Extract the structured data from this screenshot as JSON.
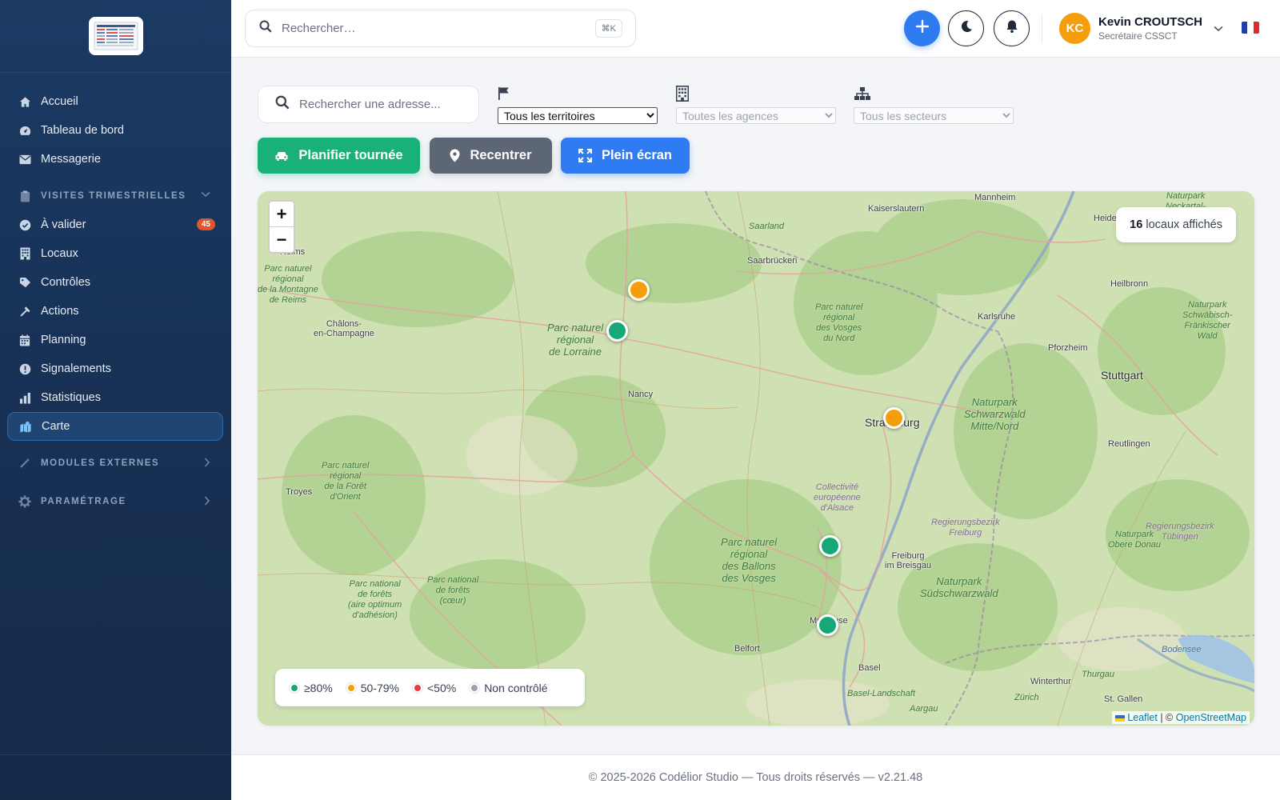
{
  "sidebar": {
    "nav_top": [
      {
        "label": "Accueil",
        "icon": "home-icon"
      },
      {
        "label": "Tableau de bord",
        "icon": "dashboard-icon"
      },
      {
        "label": "Messagerie",
        "icon": "mail-icon"
      }
    ],
    "section_visits": {
      "label": "VISITES TRIMESTRIELLES"
    },
    "nav_visits": [
      {
        "label": "À valider",
        "icon": "check-circle-icon",
        "badge": "45"
      },
      {
        "label": "Locaux",
        "icon": "building-icon"
      },
      {
        "label": "Contrôles",
        "icon": "tag-icon"
      },
      {
        "label": "Actions",
        "icon": "hammer-icon"
      },
      {
        "label": "Planning",
        "icon": "calendar-icon"
      },
      {
        "label": "Signalements",
        "icon": "alert-icon"
      },
      {
        "label": "Statistiques",
        "icon": "bar-chart-icon"
      },
      {
        "label": "Carte",
        "icon": "map-icon",
        "active": true
      }
    ],
    "section_modules": {
      "label": "MODULES EXTERNES"
    },
    "section_settings": {
      "label": "PARAMÉTRAGE"
    }
  },
  "topbar": {
    "search_placeholder": "Rechercher…",
    "search_shortcut": "⌘K",
    "user": {
      "initials": "KC",
      "name": "Kevin CROUTSCH",
      "role": "Secrétaire CSSCT"
    },
    "language": "fr",
    "accent_color": "#2e7bf0"
  },
  "filters": {
    "address_placeholder": "Rechercher une adresse...",
    "territory": {
      "selected": "Tous les territoires"
    },
    "agency": {
      "selected": "Toutes les agences"
    },
    "sector": {
      "selected": "Tous les secteurs"
    }
  },
  "actions": {
    "plan": "Planifier tournée",
    "recenter": "Recentrer",
    "fullscreen": "Plein écran"
  },
  "map": {
    "count_number": "16",
    "count_text": "locaux affichés",
    "zoom_in": "+",
    "zoom_out": "−",
    "legend": [
      {
        "label": "≥80%",
        "color": "#17a87a"
      },
      {
        "label": "50-79%",
        "color": "#f59e0b"
      },
      {
        "label": "<50%",
        "color": "#e53e3e"
      },
      {
        "label": "Non contrôlé",
        "color": "#9ca3af"
      }
    ],
    "attribution_leaflet": "Leaflet",
    "attribution_sep": " | © ",
    "attribution_osm": "OpenStreetMap",
    "places": {
      "mannheim": "Mannheim",
      "kaiserslautern": "Kaiserslautern",
      "heidelberg": "Heidelberg",
      "saarland": "Saarland",
      "saarbrucken": "Saarbrücken",
      "heilbronn": "Heilbronn",
      "reims": "Reims",
      "chalons": "Châlons-\nen-Champagne",
      "karlsruhe": "Karlsruhe",
      "pforzheim": "Pforzheim",
      "stuttgart": "Stuttgart",
      "nancy": "Nancy",
      "strasbourg": "Strasbourg",
      "reutlingen": "Reutlingen",
      "troyes": "Troyes",
      "freiburg": "Freiburg\nim Breisgau",
      "belfort": "Belfort",
      "mulhouse": "Mulhouse",
      "basel": "Basel",
      "winterthur": "Winterthur",
      "stgallen": "St. Gallen",
      "zurich": "Zürich",
      "aargau": "Aargau",
      "thurgau": "Thurgau",
      "bodensee": "Bodensee",
      "basel_land": "Basel-Landschaft"
    },
    "parks": {
      "montagne_reims": "Parc naturel\nrégional\nde la Montagne\nde Reims",
      "lorraine": "Parc naturel\nrégional\nde Lorraine",
      "vosges_nord": "Parc naturel\nrégional\ndes Vosges\ndu Nord",
      "schwarzwald_nord": "Naturpark\nSchwarzwald\nMitte/Nord",
      "foret_orient": "Parc naturel\nrégional\nde la Forêt\nd'Orient",
      "ballons": "Parc naturel\nrégional\ndes Ballons\ndes Vosges",
      "sudschwarzwald": "Naturpark\nSüdschwarzwald",
      "forets_1": "Parc national\nde forêts\n(aire optimum\nd'adhésion)",
      "forets_2": "Parc national\nde forêts\n(cœur)",
      "alsace": "Collectivité\neuropéenne\nd'Alsace",
      "neckartal": "Naturpark\nNeckartal-\nOdenwald",
      "schwab": "Naturpark\nSchwäbisch-\nFränkischer\nWald",
      "obere_donau": "Naturpark\nObere Donau",
      "rb_freiburg": "Regierungsbezirk\nFreiburg",
      "rb_tubingen": "Regierungsbezirk\nTübingen"
    }
  },
  "footer": {
    "text": "© 2025-2026 Codélior Studio — Tous droits réservés — v2.21.48"
  }
}
